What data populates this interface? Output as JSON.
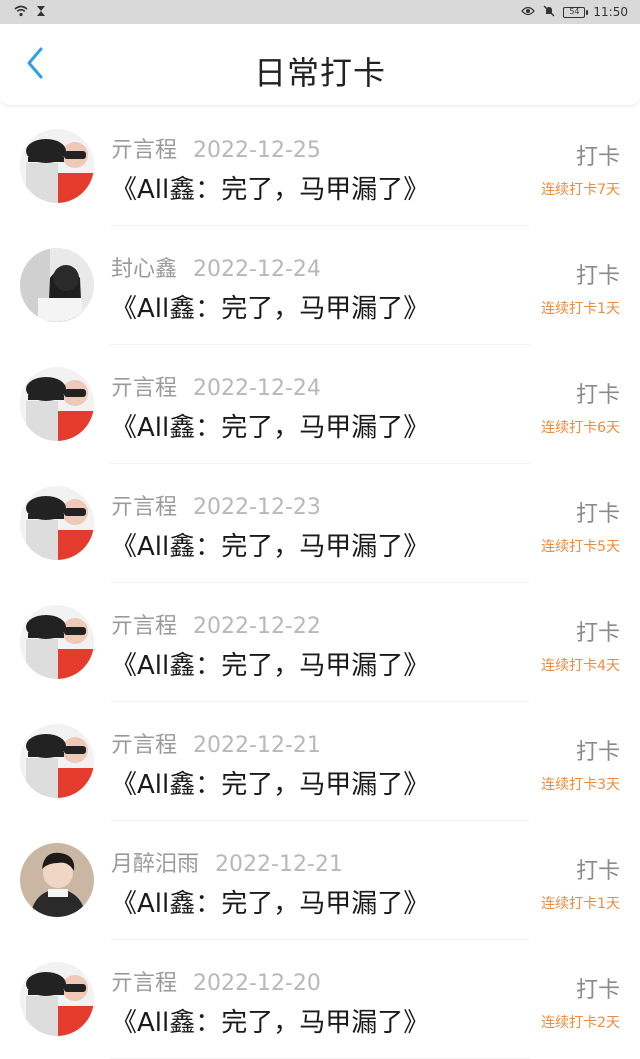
{
  "status_bar": {
    "time": "11:50",
    "battery": "54"
  },
  "header": {
    "title": "日常打卡"
  },
  "colors": {
    "accent_blue": "#2fa0e8",
    "streak_orange": "#f08a3c"
  },
  "entries": [
    {
      "user": "亓言程",
      "date": "2022-12-25",
      "book": "《All鑫：完了，马甲漏了》",
      "action": "打卡",
      "streak": "连续打卡7天",
      "avatar": "avatar-hat"
    },
    {
      "user": "封心鑫",
      "date": "2022-12-24",
      "book": "《All鑫：完了，马甲漏了》",
      "action": "打卡",
      "streak": "连续打卡1天",
      "avatar": "avatar-girl"
    },
    {
      "user": "亓言程",
      "date": "2022-12-24",
      "book": "《All鑫：完了，马甲漏了》",
      "action": "打卡",
      "streak": "连续打卡6天",
      "avatar": "avatar-hat"
    },
    {
      "user": "亓言程",
      "date": "2022-12-23",
      "book": "《All鑫：完了，马甲漏了》",
      "action": "打卡",
      "streak": "连续打卡5天",
      "avatar": "avatar-hat"
    },
    {
      "user": "亓言程",
      "date": "2022-12-22",
      "book": "《All鑫：完了，马甲漏了》",
      "action": "打卡",
      "streak": "连续打卡4天",
      "avatar": "avatar-hat"
    },
    {
      "user": "亓言程",
      "date": "2022-12-21",
      "book": "《All鑫：完了，马甲漏了》",
      "action": "打卡",
      "streak": "连续打卡3天",
      "avatar": "avatar-hat"
    },
    {
      "user": "月醉汨雨",
      "date": "2022-12-21",
      "book": "《All鑫：完了，马甲漏了》",
      "action": "打卡",
      "streak": "连续打卡1天",
      "avatar": "avatar-boy"
    },
    {
      "user": "亓言程",
      "date": "2022-12-20",
      "book": "《All鑫：完了，马甲漏了》",
      "action": "打卡",
      "streak": "连续打卡2天",
      "avatar": "avatar-hat"
    }
  ]
}
